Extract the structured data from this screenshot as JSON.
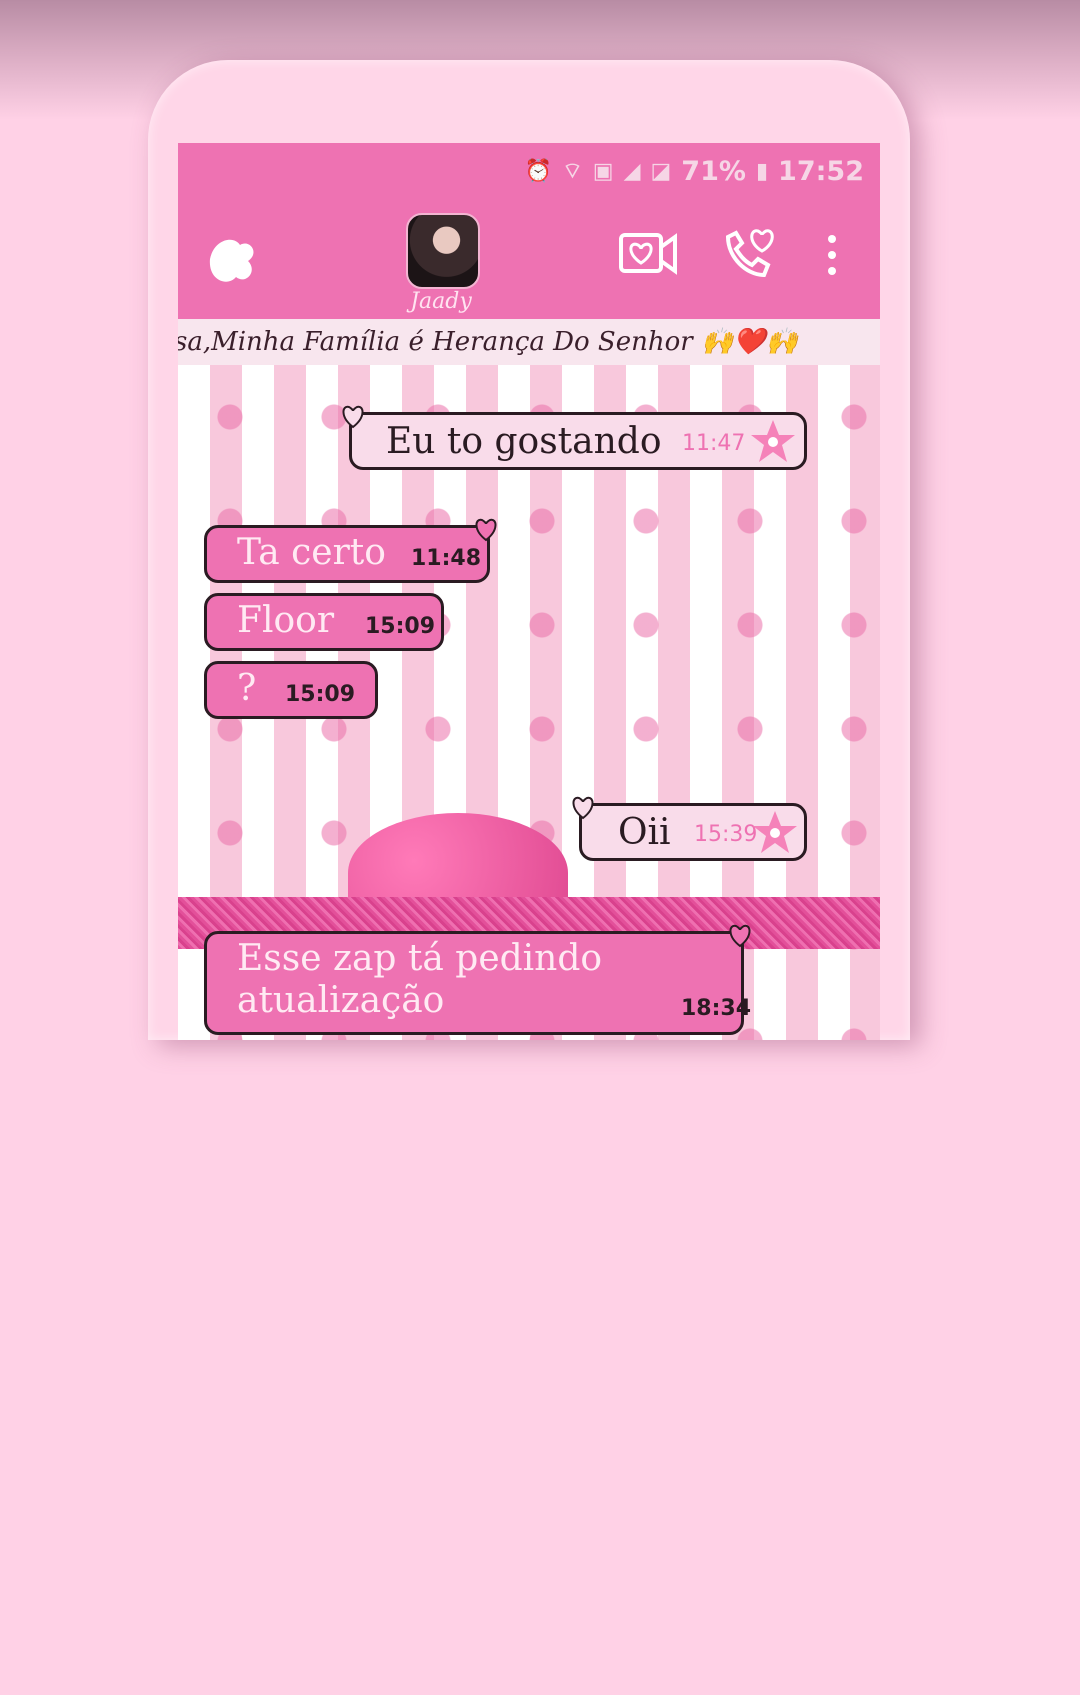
{
  "status_bar": {
    "battery": "71%",
    "time": "17:52",
    "icons": [
      "alarm-icon",
      "wifi-icon",
      "nfc-icon",
      "signal-icon",
      "signal-icon",
      "battery-icon"
    ]
  },
  "header": {
    "contact_name": "Jaady",
    "back_icon": "back-heart-icon",
    "video_icon": "video-call-icon",
    "call_icon": "phone-call-icon",
    "menu_icon": "more-vertical-icon"
  },
  "contact_status": "sa,Minha Família é Herança Do Senhor 🙌❤️🙌",
  "messages": [
    {
      "direction": "outgoing",
      "text": "Eu to gostando",
      "time": "11:47"
    },
    {
      "direction": "incoming",
      "text": "Ta certo",
      "time": "11:48"
    },
    {
      "direction": "incoming",
      "text": "Floor",
      "time": "15:09"
    },
    {
      "direction": "incoming",
      "text": "?",
      "time": "15:09"
    },
    {
      "direction": "outgoing",
      "text": "Oii",
      "time": "15:39"
    },
    {
      "direction": "incoming",
      "text": "Esse zap tá pedindo atualização",
      "time": "18:34"
    }
  ],
  "colors": {
    "header": "#ee72b2",
    "background": "#ffd1e6",
    "incoming_bubble": "#ee72b2",
    "outgoing_bubble": "#f9dcea"
  }
}
